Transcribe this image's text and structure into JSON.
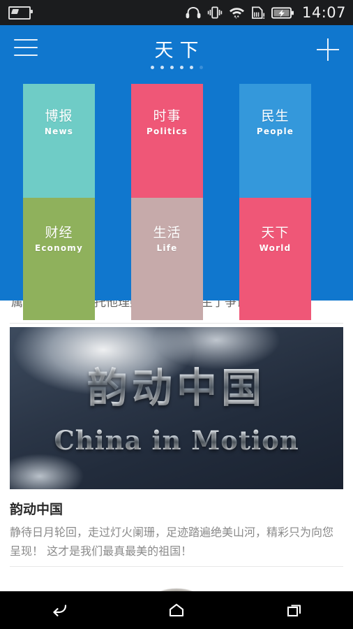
{
  "statusbar": {
    "clock": "14:07",
    "icons_left": [
      "battery-saver-icon"
    ],
    "icons_right": [
      "headphones-icon",
      "vibrate-icon",
      "wifi-icon",
      "sd-card-alert-icon",
      "battery-charging-icon"
    ]
  },
  "appbar": {
    "title": "天下",
    "menu_icon": "hamburger-menu-icon",
    "add_icon": "plus-icon",
    "pager": {
      "total": 6,
      "active": 5
    }
  },
  "categories": [
    {
      "cn": "博报",
      "en": "News",
      "color": "#6FCCC6"
    },
    {
      "cn": "时事",
      "en": "Politics",
      "color": "#EF5777"
    },
    {
      "cn": "民生",
      "en": "People",
      "color": "#3498DB"
    },
    {
      "cn": "财经",
      "en": "Economy",
      "color": "#8FB15C"
    },
    {
      "cn": "生活",
      "en": "Life",
      "color": "#C6AAAA"
    },
    {
      "cn": "天下",
      "en": "World",
      "color": "#EF5777"
    }
  ],
  "feed": {
    "clipped_text": "属，周老汉跟委托他理财的孙女士产生了争议",
    "article": {
      "banner_cn": "韵动中国",
      "banner_en": "China in Motion",
      "title": "韵动中国",
      "desc": "静待日月轮回，走过灯火阑珊，足迹踏遍绝美山河，精彩只为向您呈现！ 这才是我们最真最美的祖国！"
    }
  },
  "navbar": {
    "back": "back-icon",
    "home": "home-icon",
    "recents": "recents-icon"
  },
  "colors": {
    "brand_blue": "#1077CE",
    "statusbar_bg": "#1B1C1E",
    "navbar_bg": "#000000"
  }
}
